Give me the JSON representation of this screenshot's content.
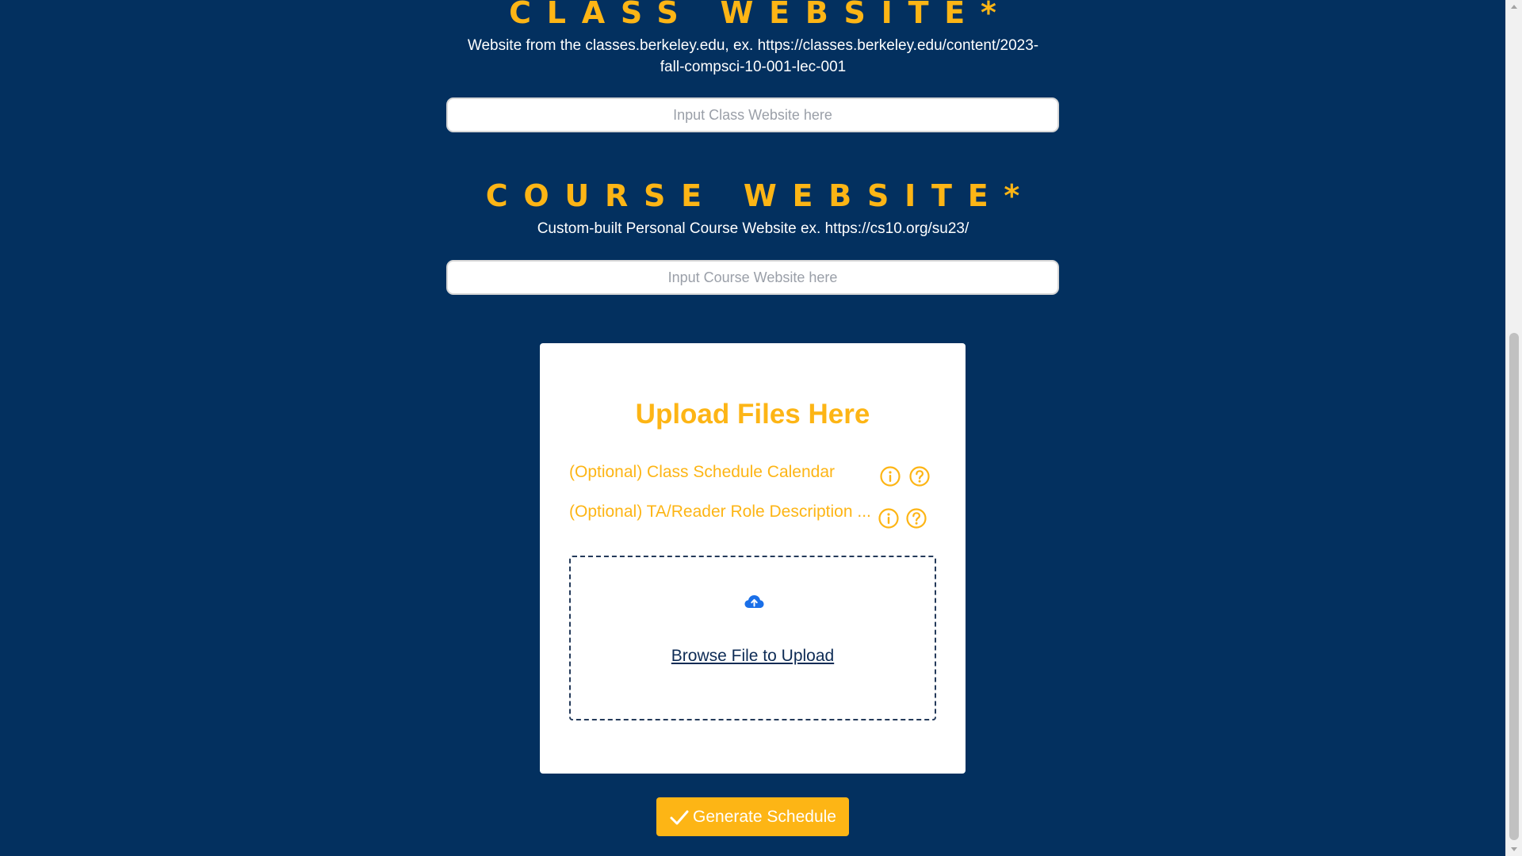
{
  "class_website": {
    "title": "CLASS WEBSITE*",
    "description": "Website from the classes.berkeley.edu, ex. https://classes.berkeley.edu/content/2023-fall-compsci-10-001-lec-001",
    "placeholder": "Input Class Website here",
    "value": ""
  },
  "course_website": {
    "title": "COURSE WEBSITE*",
    "description": "Custom-built Personal Course Website ex. https://cs10.org/su23/",
    "placeholder": "Input Course Website here",
    "value": ""
  },
  "upload": {
    "heading": "Upload Files Here",
    "options": [
      {
        "label": "(Optional) Class Schedule Calendar",
        "icons": [
          "info-icon",
          "help-icon"
        ]
      },
      {
        "label": "(Optional) TA/Reader Role Description ...",
        "icons": [
          "info-icon",
          "help-icon"
        ]
      }
    ],
    "dropzone_icon": "cloud-upload-icon",
    "browse_label": "Browse File to Upload"
  },
  "generate": {
    "icon": "checkmark-icon",
    "label": "Generate Schedule"
  },
  "colors": {
    "background": "#03305f",
    "accent": "#fdb515",
    "card": "#ffffff",
    "link": "#0d2b55",
    "cloud_icon": "#1a6fe8"
  }
}
